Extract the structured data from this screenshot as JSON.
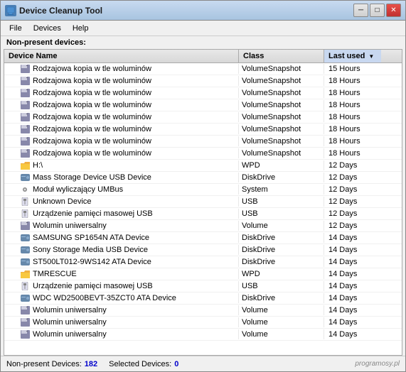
{
  "window": {
    "title": "Device Cleanup Tool",
    "icon": "🔧"
  },
  "titleButtons": {
    "minimize": "─",
    "maximize": "□",
    "close": "✕"
  },
  "menu": {
    "items": [
      "File",
      "Devices",
      "Help"
    ]
  },
  "nonPresentLabel": "Non-present devices:",
  "tableHeaders": {
    "deviceName": "Device Name",
    "class": "Class",
    "lastUsed": "Last used"
  },
  "rows": [
    {
      "name": "Rodzajowa kopia w tle woluminów",
      "class": "VolumeSnapshot",
      "lastUsed": "15 Hours",
      "icon": "floppy"
    },
    {
      "name": "Rodzajowa kopia w tle woluminów",
      "class": "VolumeSnapshot",
      "lastUsed": "18 Hours",
      "icon": "floppy"
    },
    {
      "name": "Rodzajowa kopia w tle woluminów",
      "class": "VolumeSnapshot",
      "lastUsed": "18 Hours",
      "icon": "floppy"
    },
    {
      "name": "Rodzajowa kopia w tle woluminów",
      "class": "VolumeSnapshot",
      "lastUsed": "18 Hours",
      "icon": "floppy"
    },
    {
      "name": "Rodzajowa kopia w tle woluminów",
      "class": "VolumeSnapshot",
      "lastUsed": "18 Hours",
      "icon": "floppy"
    },
    {
      "name": "Rodzajowa kopia w tle woluminów",
      "class": "VolumeSnapshot",
      "lastUsed": "18 Hours",
      "icon": "floppy"
    },
    {
      "name": "Rodzajowa kopia w tle woluminów",
      "class": "VolumeSnapshot",
      "lastUsed": "18 Hours",
      "icon": "floppy"
    },
    {
      "name": "Rodzajowa kopia w tle woluminów",
      "class": "VolumeSnapshot",
      "lastUsed": "18 Hours",
      "icon": "floppy"
    },
    {
      "name": "H:\\",
      "class": "WPD",
      "lastUsed": "12 Days",
      "icon": "folder"
    },
    {
      "name": "Mass Storage Device USB Device",
      "class": "DiskDrive",
      "lastUsed": "12 Days",
      "icon": "hdd"
    },
    {
      "name": "Moduł wyliczający UMBus",
      "class": "System",
      "lastUsed": "12 Days",
      "icon": "gear"
    },
    {
      "name": "Unknown Device",
      "class": "USB",
      "lastUsed": "12 Days",
      "icon": "usb"
    },
    {
      "name": "Urządzenie pamięci masowej USB",
      "class": "USB",
      "lastUsed": "12 Days",
      "icon": "usb"
    },
    {
      "name": "Wolumin uniwersalny",
      "class": "Volume",
      "lastUsed": "12 Days",
      "icon": "floppy"
    },
    {
      "name": "SAMSUNG SP1654N ATA Device",
      "class": "DiskDrive",
      "lastUsed": "14 Days",
      "icon": "hdd"
    },
    {
      "name": "Sony Storage Media USB Device",
      "class": "DiskDrive",
      "lastUsed": "14 Days",
      "icon": "hdd"
    },
    {
      "name": "ST500LT012-9WS142 ATA Device",
      "class": "DiskDrive",
      "lastUsed": "14 Days",
      "icon": "hdd"
    },
    {
      "name": "TMRESCUE",
      "class": "WPD",
      "lastUsed": "14 Days",
      "icon": "folder"
    },
    {
      "name": "Urządzenie pamięci masowej USB",
      "class": "USB",
      "lastUsed": "14 Days",
      "icon": "usb"
    },
    {
      "name": "WDC WD2500BEVT-35ZCT0 ATA Device",
      "class": "DiskDrive",
      "lastUsed": "14 Days",
      "icon": "hdd"
    },
    {
      "name": "Wolumin uniwersalny",
      "class": "Volume",
      "lastUsed": "14 Days",
      "icon": "floppy"
    },
    {
      "name": "Wolumin uniwersalny",
      "class": "Volume",
      "lastUsed": "14 Days",
      "icon": "floppy"
    },
    {
      "name": "Wolumin uniwersalny",
      "class": "Volume",
      "lastUsed": "14 Days",
      "icon": "floppy"
    }
  ],
  "statusBar": {
    "nonPresentLabel": "Non-present Devices:",
    "nonPresentCount": "182",
    "selectedLabel": "Selected Devices:",
    "selectedCount": "0"
  },
  "branding": "programosy.pl"
}
